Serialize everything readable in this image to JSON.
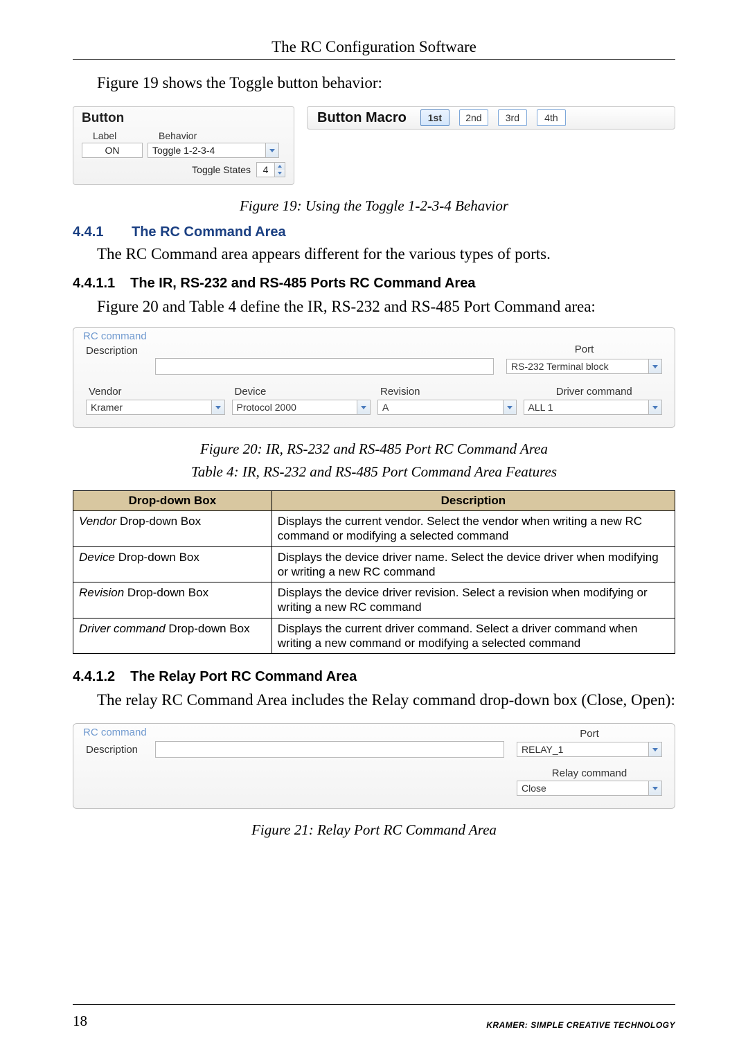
{
  "header": "The RC Configuration Software",
  "intro_line": "Figure 19 shows the Toggle button behavior:",
  "button_panel": {
    "title": "Button",
    "label_hdr": "Label",
    "behavior_hdr": "Behavior",
    "label_value": "ON",
    "behavior_value": "Toggle 1-2-3-4",
    "toggle_states_label": "Toggle States",
    "toggle_states_value": "4"
  },
  "macro": {
    "title": "Button Macro",
    "buttons": [
      "1st",
      "2nd",
      "3rd",
      "4th"
    ],
    "selected_index": 0
  },
  "fig19_caption": "Figure 19: Using the Toggle 1-2-3-4 Behavior",
  "sec_441_num": "4.4.1",
  "sec_441_title": "The RC Command Area",
  "sec_441_text": "The RC Command area appears different for the various types of ports.",
  "sec_4411_num": "4.4.1.1",
  "sec_4411_title": "The IR, RS-232 and RS-485 Ports RC Command Area",
  "sec_4411_text": "Figure 20 and Table 4 define the IR, RS-232 and RS-485 Port Command area:",
  "rc_ir": {
    "legend": "RC command",
    "description_label": "Description",
    "port_label": "Port",
    "port_value": "RS-232 Terminal block",
    "cols": {
      "vendor_label": "Vendor",
      "device_label": "Device",
      "revision_label": "Revision",
      "driver_label": "Driver command",
      "vendor_value": "Kramer",
      "device_value": "Protocol 2000",
      "revision_value": "A",
      "driver_value": "ALL 1"
    }
  },
  "fig20_caption": "Figure 20: IR, RS-232 and RS-485 Port RC Command Area",
  "table4_caption": "Table 4: IR, RS-232 and RS-485 Port Command Area Features",
  "table4": {
    "th1": "Drop-down Box",
    "th2": "Description",
    "rows": [
      {
        "it": "Vendor",
        "rest": " Drop-down Box",
        "desc": "Displays the current vendor. Select the vendor when writing a new RC command or modifying a selected command"
      },
      {
        "it": "Device",
        "rest": " Drop-down Box",
        "desc": "Displays the device driver name. Select the device driver when modifying or writing a new RC command"
      },
      {
        "it": "Revision",
        "rest": " Drop-down Box",
        "desc": "Displays the device driver revision. Select a revision when modifying or writing a new RC command"
      },
      {
        "it": "Driver command",
        "rest": " Drop-down Box",
        "desc": "Displays the current driver command. Select a driver command when writing a new command or modifying a selected command"
      }
    ]
  },
  "sec_4412_num": "4.4.1.2",
  "sec_4412_title": "The Relay Port RC Command Area",
  "sec_4412_text": "The relay RC Command Area includes the Relay command drop-down box (Close, Open):",
  "rc_relay": {
    "legend": "RC command",
    "description_label": "Description",
    "port_label": "Port",
    "port_value": "RELAY_1",
    "relay_cmd_label": "Relay command",
    "relay_cmd_value": "Close"
  },
  "fig21_caption": "Figure 21: Relay Port RC Command Area",
  "footer": {
    "page": "18",
    "brand": "KRAMER:  SIMPLE CREATIVE TECHNOLOGY"
  }
}
